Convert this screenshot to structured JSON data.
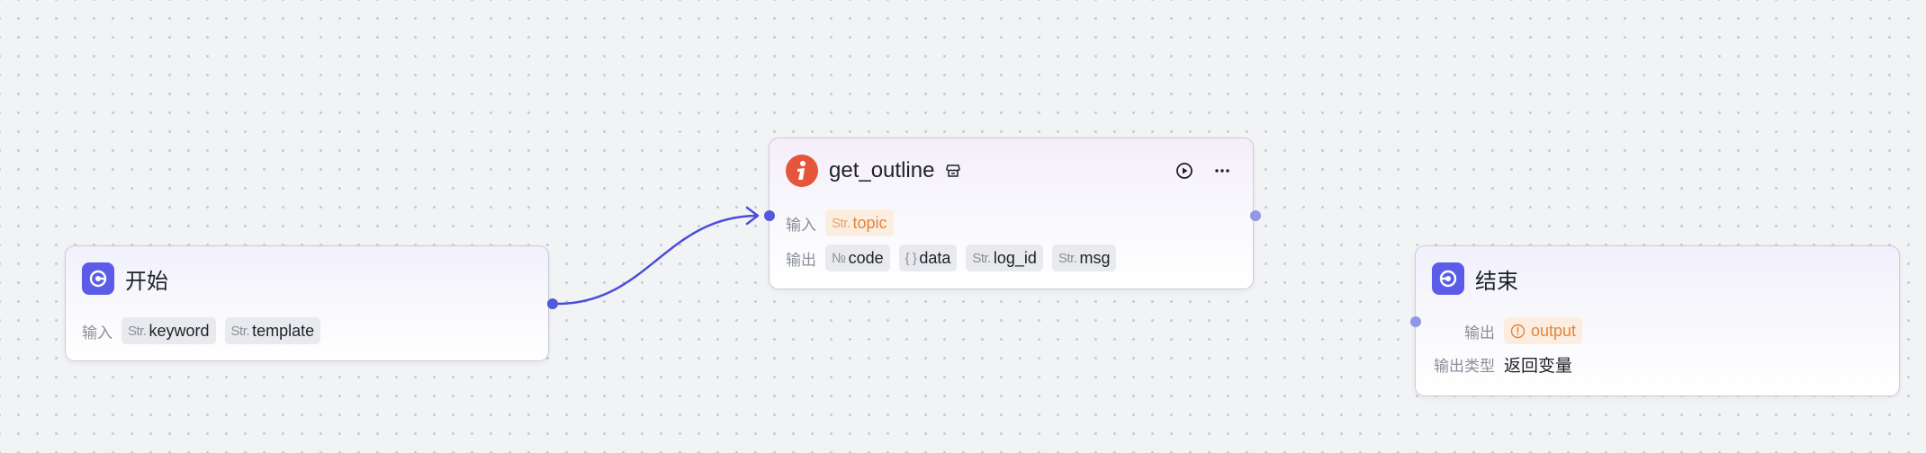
{
  "colors": {
    "accent": "#5b5de8",
    "edge": "#4a4dd8",
    "plugin_icon": "#e4553a",
    "warning_text": "#e5833a",
    "warning_bg": "#fbeee0"
  },
  "start_node": {
    "title": "开始",
    "icon": "start-node-icon",
    "input_label": "输入",
    "inputs": [
      {
        "type": "Str.",
        "name": "keyword"
      },
      {
        "type": "Str.",
        "name": "template"
      }
    ]
  },
  "plugin_node": {
    "title": "get_outline",
    "icon": "plugin-logo-icon",
    "badge_icon": "store-icon",
    "run_icon": "play-circle-icon",
    "more_icon": "more-icon",
    "input_label": "输入",
    "inputs": [
      {
        "type": "Str.",
        "name": "topic",
        "warning": true
      }
    ],
    "output_label": "输出",
    "outputs": [
      {
        "type": "№",
        "name": "code"
      },
      {
        "type": "{ }",
        "name": "data"
      },
      {
        "type": "Str.",
        "name": "log_id"
      },
      {
        "type": "Str.",
        "name": "msg"
      }
    ]
  },
  "end_node": {
    "title": "结束",
    "icon": "end-node-icon",
    "output_label": "输出",
    "output": {
      "name": "output",
      "warning": true
    },
    "output_type_label": "输出类型",
    "output_type_value": "返回变量"
  }
}
